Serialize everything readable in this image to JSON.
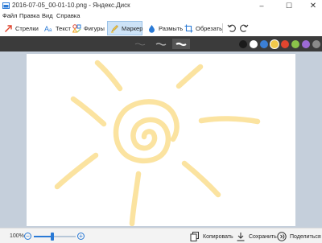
{
  "window": {
    "title": "2016-07-05_00-01-10.png - Яндекс.Диск",
    "minimize": "–",
    "maximize": "☐",
    "close": "✕"
  },
  "menu": [
    "Файл",
    "Правка",
    "Вид",
    "Справка"
  ],
  "toolbar": {
    "arrows": "Стрелки",
    "text": "Текст",
    "shapes": "Фигуры",
    "marker": "Маркер",
    "blur": "Размыть",
    "crop": "Обрезать",
    "selected_tool": "Маркер"
  },
  "palette": {
    "brush_sizes": [
      "thin",
      "medium",
      "thick"
    ],
    "selected_brush": "thick",
    "colors": [
      "#1a1a1a",
      "#ffffff",
      "#3b7fd6",
      "#f1c84b",
      "#e0452f",
      "#8bc34a",
      "#9c6ad6",
      "#8a8a8a"
    ],
    "selected_color": "#f1c84b"
  },
  "drawing": {
    "stroke_color": "#fbe3a0"
  },
  "statusbar": {
    "zoom": "100%",
    "zoom_fraction": 0.45,
    "copy": "Копировать",
    "save": "Сохранить",
    "share": "Поделиться"
  }
}
